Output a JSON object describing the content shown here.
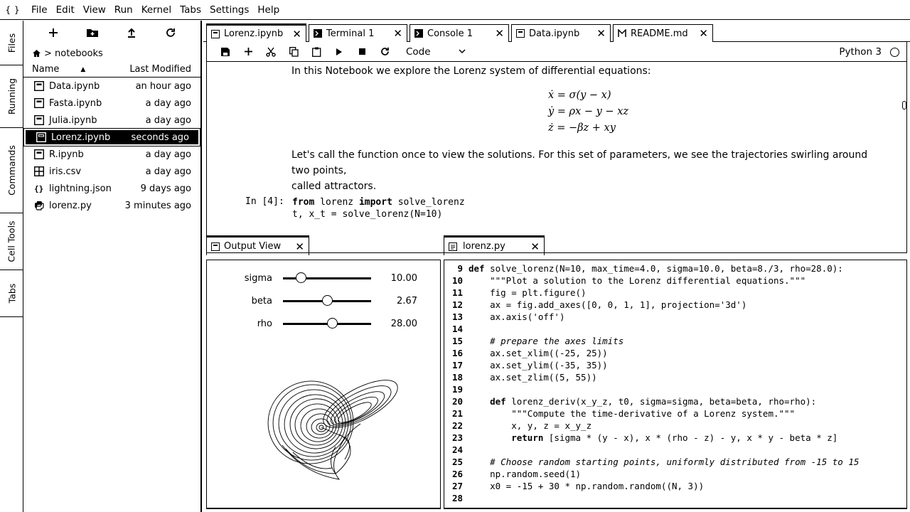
{
  "app": {
    "logo": "{ }"
  },
  "menu": [
    "File",
    "Edit",
    "View",
    "Run",
    "Kernel",
    "Tabs",
    "Settings",
    "Help"
  ],
  "left_tabs": [
    "Files",
    "Running",
    "Commands",
    "Cell Tools",
    "Tabs"
  ],
  "file_browser": {
    "breadcrumb": "notebooks",
    "columns": {
      "name": "Name",
      "modified": "Last Modified"
    },
    "files": [
      {
        "name": "Data.ipynb",
        "modified": "an hour ago",
        "icon": "notebook-icon"
      },
      {
        "name": "Fasta.ipynb",
        "modified": "a day ago",
        "icon": "notebook-icon"
      },
      {
        "name": "Julia.ipynb",
        "modified": "a day ago",
        "icon": "notebook-icon"
      },
      {
        "name": "Lorenz.ipynb",
        "modified": "seconds ago",
        "icon": "notebook-icon",
        "selected": true
      },
      {
        "name": "R.ipynb",
        "modified": "a day ago",
        "icon": "notebook-icon"
      },
      {
        "name": "iris.csv",
        "modified": "a day ago",
        "icon": "csv-icon"
      },
      {
        "name": "lightning.json",
        "modified": "9 days ago",
        "icon": "json-icon"
      },
      {
        "name": "lorenz.py",
        "modified": "3 minutes ago",
        "icon": "python-icon"
      }
    ]
  },
  "doc_tabs": [
    {
      "label": "Lorenz.ipynb",
      "active": true
    },
    {
      "label": "Terminal 1"
    },
    {
      "label": "Console 1"
    },
    {
      "label": "Data.ipynb"
    },
    {
      "label": "README.md"
    }
  ],
  "notebook": {
    "cell_type": "Code",
    "kernel": "Python 3",
    "md1": "In this Notebook we explore the Lorenz system of differential equations:",
    "eq1": "ẋ = σ(y − x)",
    "eq2": "ẏ = ρx − y − xz",
    "eq3": "ż = −βz + xy",
    "md2a": "Let's call the function once to view the solutions. For this set of parameters, we see the trajectories swirling around two points,",
    "md2b": "called attractors.",
    "prompt": "In [4]:",
    "code1_kw1": "from",
    "code1_mod": " lorenz ",
    "code1_kw2": "import",
    "code1_rest": " solve_lorenz",
    "code2": "t, x_t = solve_lorenz(N=10)"
  },
  "output_view": {
    "tab_label": "Output View",
    "sliders": [
      {
        "label": "sigma",
        "value": "10.00",
        "fraction": 0.2
      },
      {
        "label": "beta",
        "value": "2.67",
        "fraction": 0.5
      },
      {
        "label": "rho",
        "value": "28.00",
        "fraction": 0.56
      }
    ]
  },
  "editor": {
    "tab_label": "lorenz.py",
    "lines": [
      {
        "n": "9",
        "segs": [
          [
            "kw",
            "def"
          ],
          [
            "",
            "solve_lorenz(N=10, max_time=4.0, sigma=10.0, beta=8./3, rho=28.0):"
          ]
        ],
        "indent": "",
        "sep": " "
      },
      {
        "n": "10",
        "segs": [
          [
            "",
            "\"\"\"Plot a solution to the Lorenz differential equations.\"\"\""
          ]
        ],
        "indent": "    "
      },
      {
        "n": "11",
        "segs": [
          [
            "",
            "fig = plt.figure()"
          ]
        ],
        "indent": "    "
      },
      {
        "n": "12",
        "segs": [
          [
            "",
            "ax = fig.add_axes([0, 0, 1, 1], projection='3d')"
          ]
        ],
        "indent": "    "
      },
      {
        "n": "13",
        "segs": [
          [
            "",
            "ax.axis('off')"
          ]
        ],
        "indent": "    "
      },
      {
        "n": "14",
        "segs": [
          [
            "",
            ""
          ]
        ],
        "indent": ""
      },
      {
        "n": "15",
        "segs": [
          [
            "cm",
            "# prepare the axes limits"
          ]
        ],
        "indent": "    "
      },
      {
        "n": "16",
        "segs": [
          [
            "",
            "ax.set_xlim((-25, 25))"
          ]
        ],
        "indent": "    "
      },
      {
        "n": "17",
        "segs": [
          [
            "",
            "ax.set_ylim((-35, 35))"
          ]
        ],
        "indent": "    "
      },
      {
        "n": "18",
        "segs": [
          [
            "",
            "ax.set_zlim((5, 55))"
          ]
        ],
        "indent": "    "
      },
      {
        "n": "19",
        "segs": [
          [
            "",
            ""
          ]
        ],
        "indent": ""
      },
      {
        "n": "20",
        "segs": [
          [
            "kw",
            "def"
          ],
          [
            "",
            "lorenz_deriv(x_y_z, t0, sigma=sigma, beta=beta, rho=rho):"
          ]
        ],
        "indent": "    ",
        "sep": " "
      },
      {
        "n": "21",
        "segs": [
          [
            "",
            "\"\"\"Compute the time-derivative of a Lorenz system.\"\"\""
          ]
        ],
        "indent": "        "
      },
      {
        "n": "22",
        "segs": [
          [
            "",
            "x, y, z = x_y_z"
          ]
        ],
        "indent": "        "
      },
      {
        "n": "23",
        "segs": [
          [
            "kw",
            "return"
          ],
          [
            "",
            "[sigma * (y - x), x * (rho - z) - y, x * y - beta * z]"
          ]
        ],
        "indent": "        ",
        "sep": " "
      },
      {
        "n": "24",
        "segs": [
          [
            "",
            ""
          ]
        ],
        "indent": ""
      },
      {
        "n": "25",
        "segs": [
          [
            "cm",
            "# Choose random starting points, uniformly distributed from -15 to 15"
          ]
        ],
        "indent": "    "
      },
      {
        "n": "26",
        "segs": [
          [
            "",
            "np.random.seed(1)"
          ]
        ],
        "indent": "    "
      },
      {
        "n": "27",
        "segs": [
          [
            "",
            "x0 = -15 + 30 * np.random.random((N, 3))"
          ]
        ],
        "indent": "    "
      },
      {
        "n": "28",
        "segs": [
          [
            "",
            ""
          ]
        ],
        "indent": ""
      }
    ]
  }
}
